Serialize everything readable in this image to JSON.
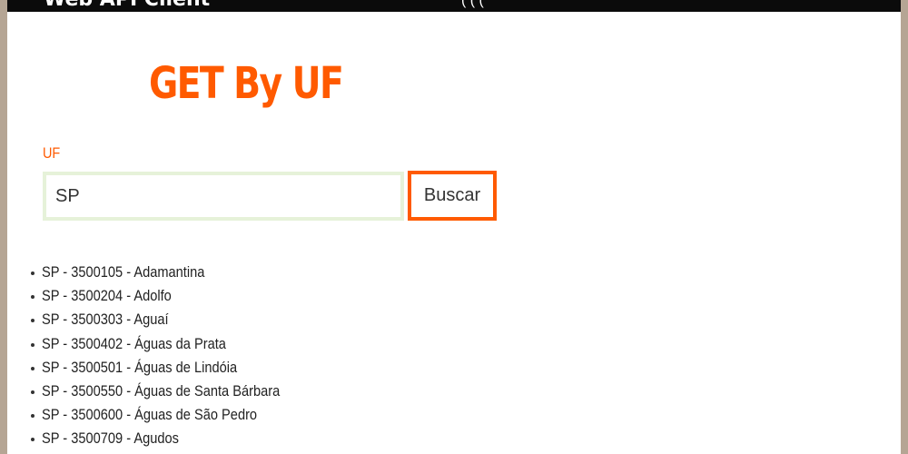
{
  "header": {
    "brand": "Web API Client",
    "nav": "( ( ("
  },
  "page": {
    "title": "GET By UF"
  },
  "form": {
    "uf_label": "UF",
    "uf_value": "SP",
    "button_label": "Buscar"
  },
  "colors": {
    "accent": "#ff5a00",
    "input_border": "#e6f2d9",
    "topbar": "#0b0b0b",
    "outer_background": "#b5a594"
  },
  "results": [
    "SP - 3500105 - Adamantina",
    "SP - 3500204 - Adolfo",
    "SP - 3500303 - Aguaí",
    "SP - 3500402 - Águas da Prata",
    "SP - 3500501 - Águas de Lindóia",
    "SP - 3500550 - Águas de Santa Bárbara",
    "SP - 3500600 - Águas de São Pedro",
    "SP - 3500709 - Agudos"
  ]
}
